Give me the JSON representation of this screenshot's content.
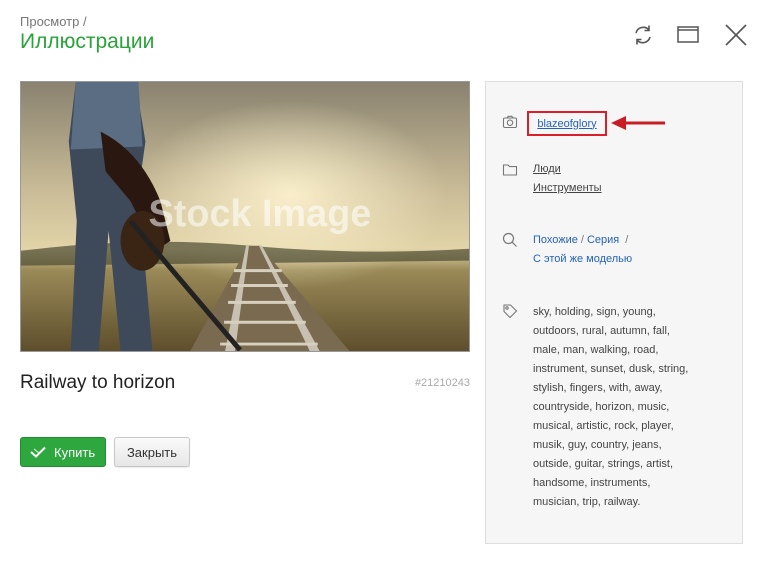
{
  "header": {
    "breadcrumb": "Просмотр /",
    "title": "Иллюстрации"
  },
  "window_controls": {
    "refresh_icon": "refresh-icon",
    "window_icon": "window-icon",
    "close_icon": "close-icon"
  },
  "photo": {
    "watermark": "Stock Image",
    "title": "Railway to horizon",
    "id": "#21210243"
  },
  "actions": {
    "buy_label": "Купить",
    "close_label": "Закрыть"
  },
  "panel": {
    "author": "blazeofglory",
    "categories": [
      "Люди",
      "Инструменты"
    ],
    "similar_label": "Похожие",
    "series_label": "Серия",
    "separator": "/",
    "same_model_label": "С этой же моделью",
    "tags": [
      [
        "sky,",
        "holding,",
        "sign,",
        "young,"
      ],
      [
        "outdoors,",
        "rural,",
        "autumn,",
        "fall,"
      ],
      [
        "male,",
        "man,",
        "walking,",
        "road,"
      ],
      [
        "instrument,",
        "sunset,",
        "dusk,",
        "string,"
      ],
      [
        "stylish,",
        "fingers,",
        "with,",
        "away,"
      ],
      [
        "countryside,",
        "horizon,",
        "music,"
      ],
      [
        "musical,",
        "artistic,",
        "rock,",
        "player,"
      ],
      [
        "musik,",
        "guy,",
        "country,",
        "jeans,"
      ],
      [
        "outside,",
        "guitar,",
        "strings,",
        "artist,"
      ],
      [
        "handsome,",
        "instruments,"
      ],
      [
        "musician,",
        "trip,",
        "railway."
      ]
    ]
  },
  "colors": {
    "accent_green": "#2aa33a",
    "link_blue": "#2563b8",
    "highlight_red": "#d9202a"
  }
}
